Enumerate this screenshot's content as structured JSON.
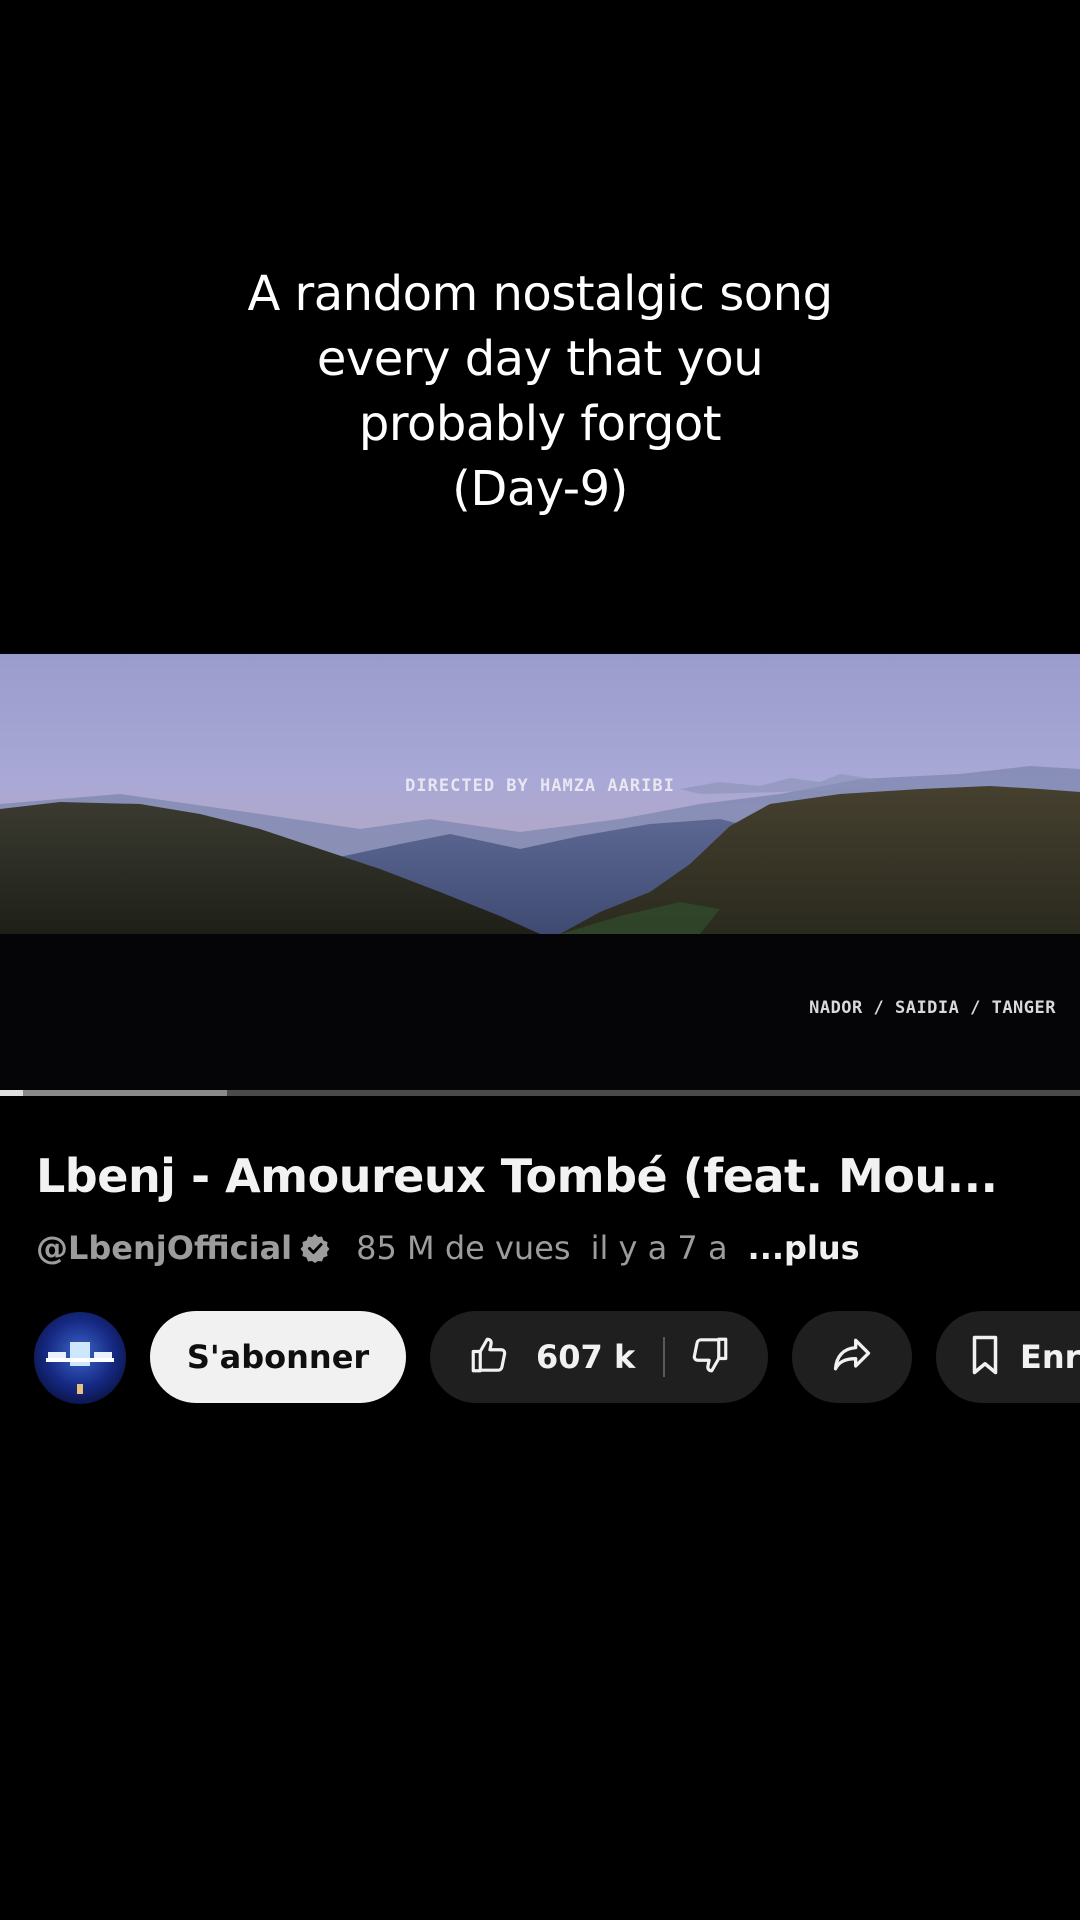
{
  "caption": {
    "lines": [
      "A random nostalgic song",
      "every day that you",
      "probably forgot",
      "(Day-9)"
    ]
  },
  "video": {
    "credit_top": "DIRECTED  BY HAMZA AARIBI",
    "credit_bottom": "NADOR / SAIDIA / TANGER",
    "progress_played": 0.021,
    "progress_buffered": 0.21
  },
  "info": {
    "title": "Lbenj - Amoureux Tombé (feat. Mou...",
    "channel_handle": "@LbenjOfficial",
    "views": "85 M de vues",
    "age": "il y a 7 a",
    "more": "...plus"
  },
  "actions": {
    "subscribe_label": "S'abonner",
    "like_count": "607 k",
    "save_label": "Enr"
  },
  "icons": {
    "verified": "verified-icon",
    "like": "thumb-up-icon",
    "dislike": "thumb-down-icon",
    "share": "share-icon",
    "save": "bookmark-icon"
  },
  "colors": {
    "background": "#000000",
    "button_dark": "#1f1f1f",
    "subscribe_bg": "#f1f1f1",
    "text_secondary": "#9c9c9c"
  }
}
